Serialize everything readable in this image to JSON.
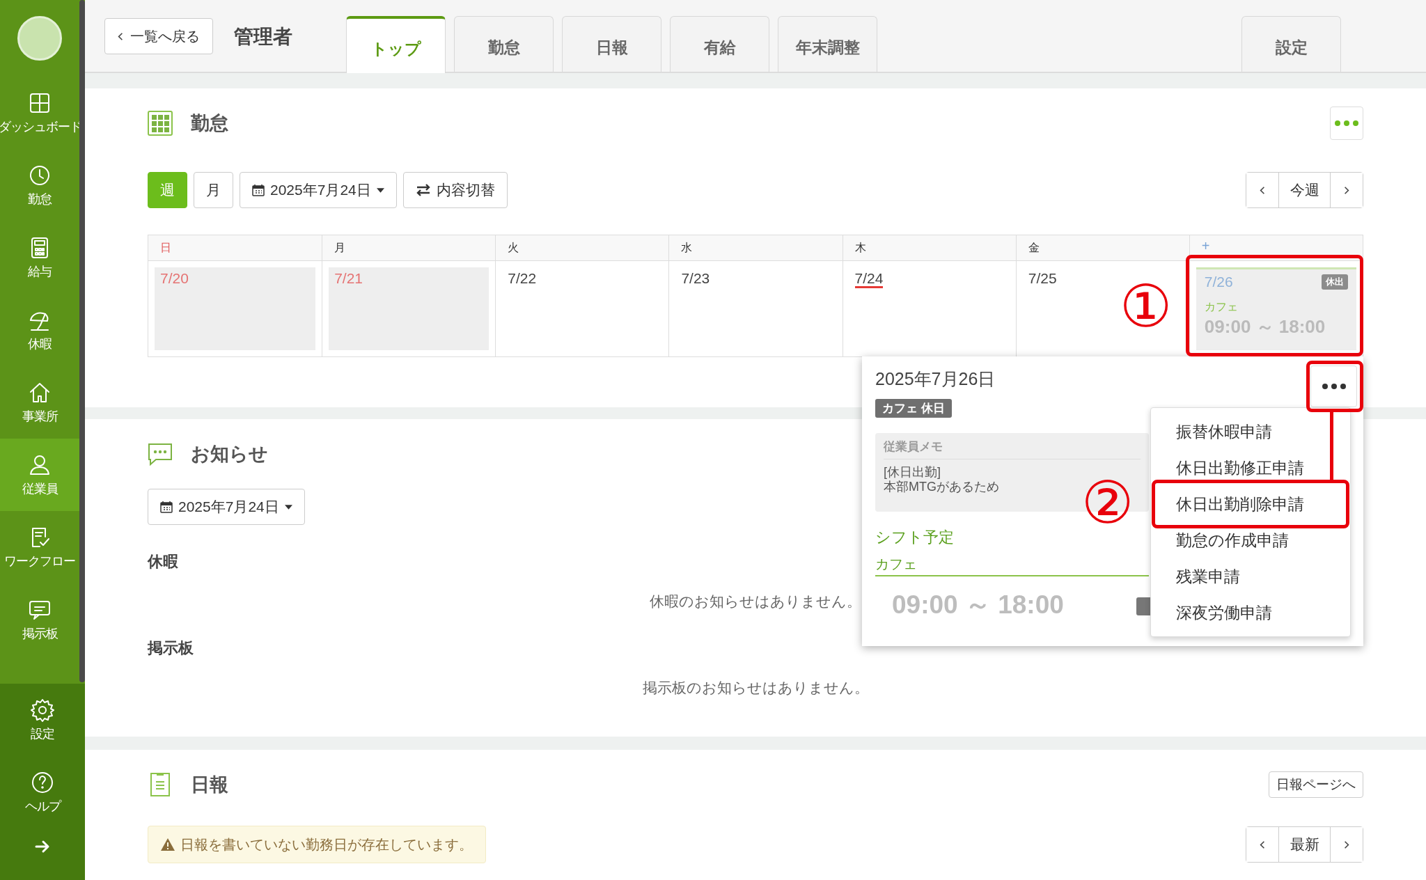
{
  "sidebar": {
    "items": [
      {
        "label": "ダッシュボード",
        "selected": false
      },
      {
        "label": "勤怠",
        "selected": false
      },
      {
        "label": "給与",
        "selected": false
      },
      {
        "label": "休暇",
        "selected": false
      },
      {
        "label": "事業所",
        "selected": false
      },
      {
        "label": "従業員",
        "selected": true
      },
      {
        "label": "ワークフロー",
        "selected": false
      },
      {
        "label": "掲示板",
        "selected": false
      }
    ],
    "footer_items": [
      {
        "label": "設定"
      },
      {
        "label": "ヘルプ"
      }
    ]
  },
  "header": {
    "back_button": "一覧へ戻る",
    "title": "管理者",
    "tabs": [
      {
        "label": "トップ",
        "selected": true
      },
      {
        "label": "勤怠",
        "selected": false
      },
      {
        "label": "日報",
        "selected": false
      },
      {
        "label": "有給",
        "selected": false
      },
      {
        "label": "年末調整",
        "selected": false
      }
    ],
    "settings_tab": {
      "label": "設定",
      "selected": false
    }
  },
  "attendance": {
    "title": "勤怠",
    "view_buttons": [
      {
        "label": "週",
        "selected": true
      },
      {
        "label": "月",
        "selected": false
      }
    ],
    "date_picker": "2025年7月24日",
    "toggle_button": "内容切替",
    "nav_current": "今週",
    "calendar": {
      "headers": [
        {
          "label": "日",
          "kind": "sunday"
        },
        {
          "label": "月",
          "kind": "normal"
        },
        {
          "label": "火",
          "kind": "normal"
        },
        {
          "label": "水",
          "kind": "normal"
        },
        {
          "label": "木",
          "kind": "normal"
        },
        {
          "label": "金",
          "kind": "normal"
        },
        {
          "label": "+",
          "kind": "add"
        }
      ],
      "days": [
        {
          "date": "7/20",
          "holiday": true,
          "today": false
        },
        {
          "date": "7/21",
          "holiday": true,
          "today": false
        },
        {
          "date": "7/22",
          "holiday": false,
          "today": false
        },
        {
          "date": "7/23",
          "holiday": false,
          "today": false
        },
        {
          "date": "7/24",
          "holiday": false,
          "today": true
        },
        {
          "date": "7/25",
          "holiday": false,
          "today": false
        },
        {
          "date": "7/26",
          "holiday": false,
          "today": false,
          "shift": {
            "badge": "休出",
            "place": "カフェ",
            "time": "09:00 ～ 18:00"
          }
        }
      ]
    }
  },
  "popup": {
    "date": "2025年7月26日",
    "tag": "カフェ 休日",
    "memo": {
      "label": "従業員メモ",
      "lines": [
        "[休日出勤]",
        "本部MTGがあるため"
      ]
    },
    "shift_heading": "シフト予定",
    "shift_place": "カフェ",
    "shift_time": "09:00 ～ 18:00",
    "menu": [
      "振替休暇申請",
      "休日出勤修正申請",
      "休日出勤削除申請",
      "勤怠の作成申請",
      "残業申請",
      "深夜労働申請"
    ]
  },
  "annotations": [
    {
      "label": "①"
    },
    {
      "label": "②"
    }
  ],
  "notices": {
    "title": "お知らせ",
    "date_picker": "2025年7月24日",
    "groups": [
      {
        "heading": "休暇",
        "empty": "休暇のお知らせはありません。"
      },
      {
        "heading": "掲示板",
        "empty": "掲示板のお知らせはありません。"
      }
    ]
  },
  "daily": {
    "title": "日報",
    "page_button": "日報ページへ",
    "warning": "日報を書いていない勤務日が存在しています。",
    "nav_current": "最新"
  }
}
